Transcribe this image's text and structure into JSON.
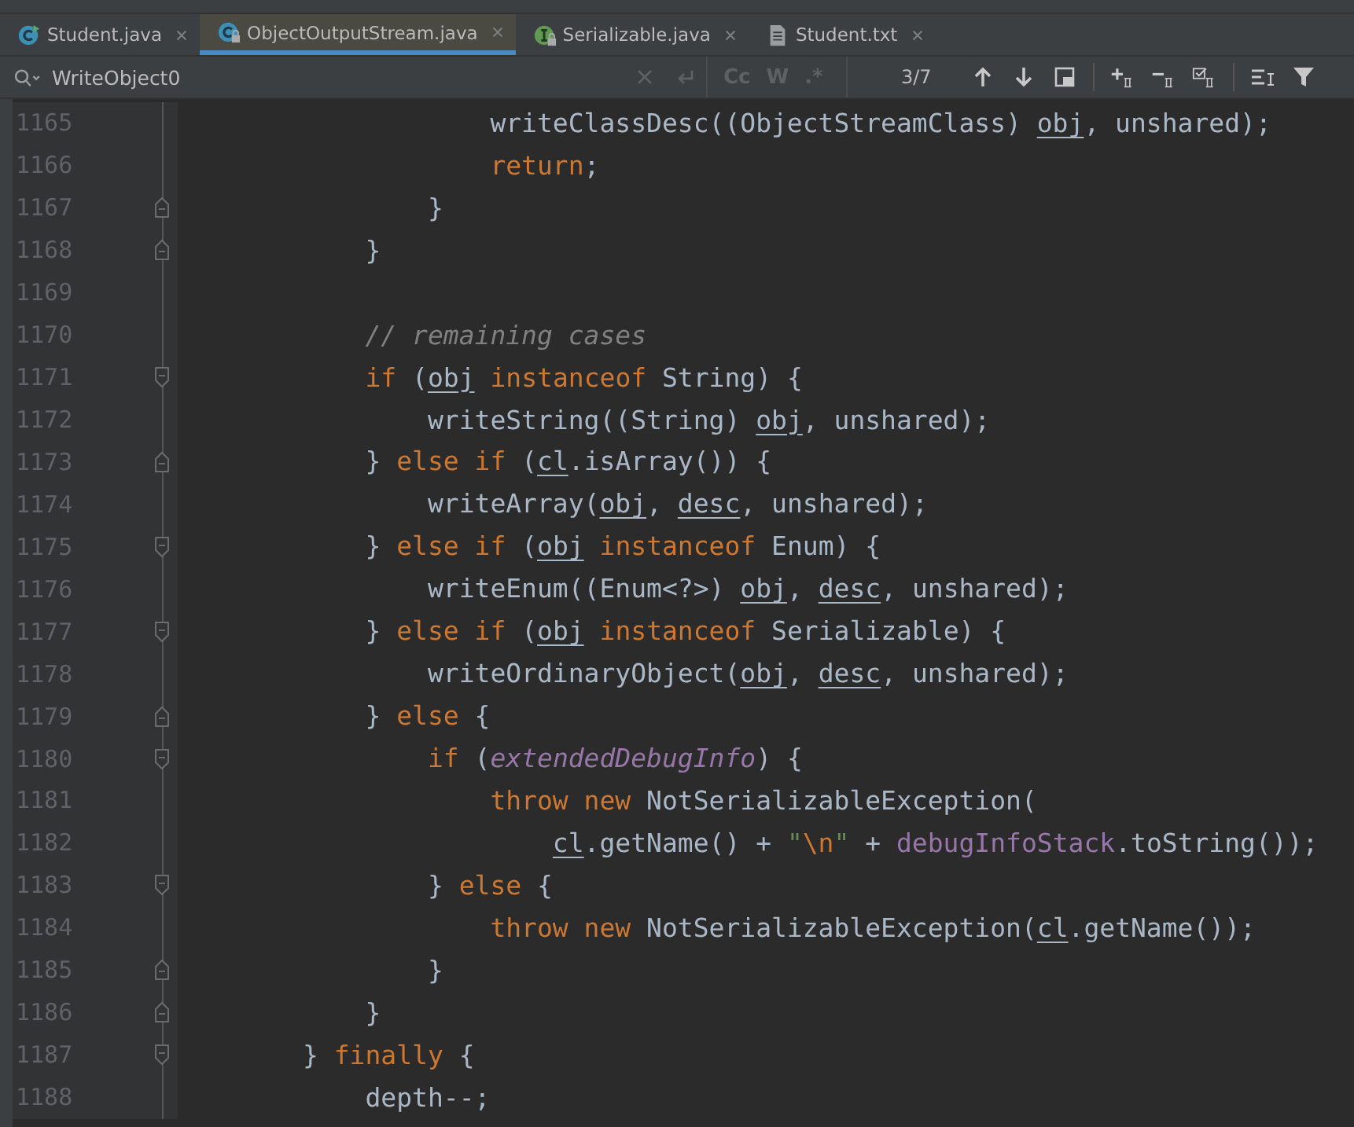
{
  "tabs": [
    {
      "label": "Student.java",
      "kind": "main",
      "selected": false
    },
    {
      "label": "ObjectOutputStream.java",
      "kind": "class",
      "selected": true
    },
    {
      "label": "Serializable.java",
      "kind": "interface",
      "selected": false
    },
    {
      "label": "Student.txt",
      "kind": "text",
      "selected": false
    }
  ],
  "search": {
    "value": "WriteObject0",
    "match_case": "Cc",
    "words": "W",
    "regex": ".*",
    "count": "3/7"
  },
  "lines": [
    {
      "number": "1165",
      "fold_start": false,
      "fold_end": false,
      "tokens": [
        {
          "t": "                    writeClassDesc((ObjectStreamClass) ",
          "kind": "plain"
        },
        {
          "t": "obj",
          "kind": "variable"
        },
        {
          "t": ", unshared);",
          "kind": "plain"
        }
      ]
    },
    {
      "number": "1166",
      "fold_start": false,
      "fold_end": false,
      "tokens": [
        {
          "t": "                    return",
          "kind": "keyword"
        },
        {
          "t": ";",
          "kind": "plain"
        }
      ]
    },
    {
      "number": "1167",
      "fold_start": false,
      "fold_end": true,
      "tokens": [
        {
          "t": "                }",
          "kind": "plain"
        }
      ]
    },
    {
      "number": "1168",
      "fold_start": false,
      "fold_end": true,
      "tokens": [
        {
          "t": "            }",
          "kind": "plain"
        }
      ]
    },
    {
      "number": "1169",
      "fold_start": false,
      "fold_end": false
    },
    {
      "number": "1170",
      "fold_start": false,
      "fold_end": false,
      "tokens": [
        {
          "t": "            // remaining cases",
          "kind": "comment"
        }
      ]
    },
    {
      "number": "1171",
      "fold_start": true,
      "fold_end": false,
      "tokens": [
        {
          "t": "            if",
          "kind": "keyword"
        },
        {
          "t": " (",
          "kind": "plain"
        },
        {
          "t": "obj",
          "kind": "variable"
        },
        {
          "t": " instanceof",
          "kind": "keyword"
        },
        {
          "t": " String) {",
          "kind": "plain"
        }
      ]
    },
    {
      "number": "1172",
      "fold_start": false,
      "fold_end": false,
      "tokens": [
        {
          "t": "                writeString((String) ",
          "kind": "plain"
        },
        {
          "t": "obj",
          "kind": "variable"
        },
        {
          "t": ", unshared);",
          "kind": "plain"
        }
      ]
    },
    {
      "number": "1173",
      "fold_start": false,
      "fold_end": true,
      "tokens": [
        {
          "t": "            } ",
          "kind": "plain"
        },
        {
          "t": "else if",
          "kind": "keyword"
        },
        {
          "t": " (",
          "kind": "plain"
        },
        {
          "t": "cl",
          "kind": "variable"
        },
        {
          "t": ".isArray()) {",
          "kind": "plain"
        }
      ]
    },
    {
      "number": "1174",
      "fold_start": false,
      "fold_end": false,
      "tokens": [
        {
          "t": "                writeArray(",
          "kind": "plain"
        },
        {
          "t": "obj",
          "kind": "variable"
        },
        {
          "t": ", ",
          "kind": "plain"
        },
        {
          "t": "desc",
          "kind": "variable"
        },
        {
          "t": ", unshared);",
          "kind": "plain"
        }
      ]
    },
    {
      "number": "1175",
      "fold_start": true,
      "fold_end": false,
      "tokens": [
        {
          "t": "            } ",
          "kind": "plain"
        },
        {
          "t": "else if",
          "kind": "keyword"
        },
        {
          "t": " (",
          "kind": "plain"
        },
        {
          "t": "obj",
          "kind": "variable"
        },
        {
          "t": " instanceof",
          "kind": "keyword"
        },
        {
          "t": " Enum) {",
          "kind": "plain"
        }
      ]
    },
    {
      "number": "1176",
      "fold_start": false,
      "fold_end": false,
      "tokens": [
        {
          "t": "                writeEnum((Enum<?>) ",
          "kind": "plain"
        },
        {
          "t": "obj",
          "kind": "variable"
        },
        {
          "t": ", ",
          "kind": "plain"
        },
        {
          "t": "desc",
          "kind": "variable"
        },
        {
          "t": ", unshared);",
          "kind": "plain"
        }
      ]
    },
    {
      "number": "1177",
      "fold_start": true,
      "fold_end": false,
      "tokens": [
        {
          "t": "            } ",
          "kind": "plain"
        },
        {
          "t": "else if",
          "kind": "keyword"
        },
        {
          "t": " (",
          "kind": "plain"
        },
        {
          "t": "obj",
          "kind": "variable"
        },
        {
          "t": " instanceof",
          "kind": "keyword"
        },
        {
          "t": " Serializable) {",
          "kind": "plain"
        }
      ]
    },
    {
      "number": "1178",
      "fold_start": false,
      "fold_end": false,
      "tokens": [
        {
          "t": "                writeOrdinaryObject(",
          "kind": "plain"
        },
        {
          "t": "obj",
          "kind": "variable"
        },
        {
          "t": ", ",
          "kind": "plain"
        },
        {
          "t": "desc",
          "kind": "variable"
        },
        {
          "t": ", unshared);",
          "kind": "plain"
        }
      ]
    },
    {
      "number": "1179",
      "fold_start": false,
      "fold_end": true,
      "tokens": [
        {
          "t": "            } ",
          "kind": "plain"
        },
        {
          "t": "else",
          "kind": "keyword"
        },
        {
          "t": " {",
          "kind": "plain"
        }
      ]
    },
    {
      "number": "1180",
      "fold_start": true,
      "fold_end": false,
      "tokens": [
        {
          "t": "                if",
          "kind": "keyword"
        },
        {
          "t": " (",
          "kind": "plain"
        },
        {
          "t": "extendedDebugInfo",
          "kind": "static"
        },
        {
          "t": ") {",
          "kind": "plain"
        }
      ]
    },
    {
      "number": "1181",
      "fold_start": false,
      "fold_end": false,
      "tokens": [
        {
          "t": "                    throw new",
          "kind": "keyword"
        },
        {
          "t": " NotSerializableException(",
          "kind": "plain"
        }
      ]
    },
    {
      "number": "1182",
      "fold_start": false,
      "fold_end": false,
      "tokens": [
        {
          "t": "                        cl",
          "kind": "variable"
        },
        {
          "t": ".getName() + ",
          "kind": "plain"
        },
        {
          "t": "\"",
          "kind": "string"
        },
        {
          "t": "\\n",
          "kind": "escape"
        },
        {
          "t": "\"",
          "kind": "string"
        },
        {
          "t": " + ",
          "kind": "plain"
        },
        {
          "t": "debugInfoStack",
          "kind": "field"
        },
        {
          "t": ".toString());",
          "kind": "plain"
        }
      ]
    },
    {
      "number": "1183",
      "fold_start": true,
      "fold_end": false,
      "tokens": [
        {
          "t": "                } ",
          "kind": "plain"
        },
        {
          "t": "else",
          "kind": "keyword"
        },
        {
          "t": " {",
          "kind": "plain"
        }
      ]
    },
    {
      "number": "1184",
      "fold_start": false,
      "fold_end": false,
      "tokens": [
        {
          "t": "                    throw new",
          "kind": "keyword"
        },
        {
          "t": " NotSerializableException(",
          "kind": "plain"
        },
        {
          "t": "cl",
          "kind": "variable"
        },
        {
          "t": ".getName());",
          "kind": "plain"
        }
      ]
    },
    {
      "number": "1185",
      "fold_start": false,
      "fold_end": true,
      "tokens": [
        {
          "t": "                }",
          "kind": "plain"
        }
      ]
    },
    {
      "number": "1186",
      "fold_start": false,
      "fold_end": true,
      "tokens": [
        {
          "t": "            }",
          "kind": "plain"
        }
      ]
    },
    {
      "number": "1187",
      "fold_start": true,
      "fold_end": false,
      "tokens": [
        {
          "t": "        } ",
          "kind": "plain"
        },
        {
          "t": "finally",
          "kind": "keyword"
        },
        {
          "t": " {",
          "kind": "plain"
        }
      ]
    },
    {
      "number": "1188",
      "fold_start": false,
      "fold_end": false,
      "tokens": [
        {
          "t": "            depth--;",
          "kind": "plain"
        }
      ]
    }
  ]
}
